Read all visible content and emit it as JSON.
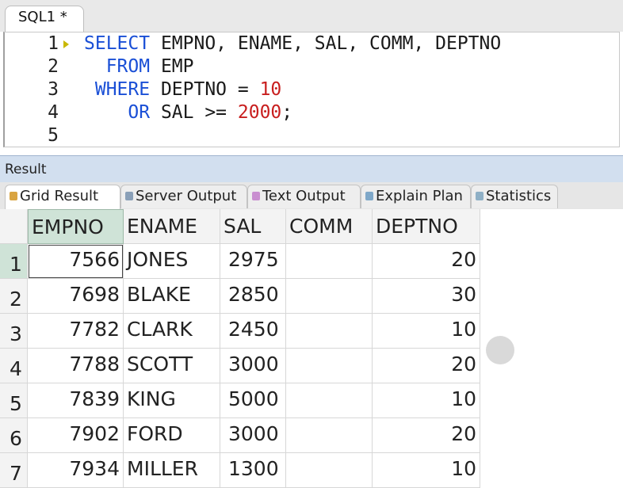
{
  "editor": {
    "tab_label": "SQL1 *",
    "line_numbers": [
      "1",
      "2",
      "3",
      "4",
      "5"
    ],
    "lines": [
      [
        {
          "t": "SELECT",
          "k": "kw"
        },
        {
          "t": " EMPNO, ENAME, SAL, COMM, DEPTNO",
          "k": ""
        }
      ],
      [
        {
          "t": "  FROM",
          "k": "kw"
        },
        {
          "t": " EMP",
          "k": ""
        }
      ],
      [
        {
          "t": " WHERE",
          "k": "kw"
        },
        {
          "t": " DEPTNO = ",
          "k": ""
        },
        {
          "t": "10",
          "k": "num"
        }
      ],
      [
        {
          "t": "    OR",
          "k": "kw"
        },
        {
          "t": " SAL >= ",
          "k": ""
        },
        {
          "t": "2000",
          "k": "num"
        },
        {
          "t": ";",
          "k": ""
        }
      ],
      []
    ]
  },
  "result": {
    "title": "Result",
    "tabs": [
      {
        "label": "Grid Result",
        "icon": "grid-result-icon",
        "color": "#d9a441",
        "active": true
      },
      {
        "label": "Server Output",
        "icon": "server-output-icon",
        "color": "#8aa0b8",
        "active": false
      },
      {
        "label": "Text Output",
        "icon": "text-output-icon",
        "color": "#c98fd0",
        "active": false
      },
      {
        "label": "Explain Plan",
        "icon": "explain-plan-icon",
        "color": "#7fa8c9",
        "active": false
      },
      {
        "label": "Statistics",
        "icon": "statistics-icon",
        "color": "#8fb0c6",
        "active": false
      }
    ]
  },
  "grid": {
    "columns": [
      "EMPNO",
      "ENAME",
      "SAL",
      "COMM",
      "DEPTNO"
    ],
    "rows": [
      {
        "n": "1",
        "EMPNO": "7566",
        "ENAME": "JONES",
        "SAL": "2975",
        "COMM": "",
        "DEPTNO": "20"
      },
      {
        "n": "2",
        "EMPNO": "7698",
        "ENAME": "BLAKE",
        "SAL": "2850",
        "COMM": "",
        "DEPTNO": "30"
      },
      {
        "n": "3",
        "EMPNO": "7782",
        "ENAME": "CLARK",
        "SAL": "2450",
        "COMM": "",
        "DEPTNO": "10"
      },
      {
        "n": "4",
        "EMPNO": "7788",
        "ENAME": "SCOTT",
        "SAL": "3000",
        "COMM": "",
        "DEPTNO": "20"
      },
      {
        "n": "5",
        "EMPNO": "7839",
        "ENAME": "KING",
        "SAL": "5000",
        "COMM": "",
        "DEPTNO": "10"
      },
      {
        "n": "6",
        "EMPNO": "7902",
        "ENAME": "FORD",
        "SAL": "3000",
        "COMM": "",
        "DEPTNO": "20"
      },
      {
        "n": "7",
        "EMPNO": "7934",
        "ENAME": "MILLER",
        "SAL": "1300",
        "COMM": "",
        "DEPTNO": "10"
      }
    ]
  }
}
